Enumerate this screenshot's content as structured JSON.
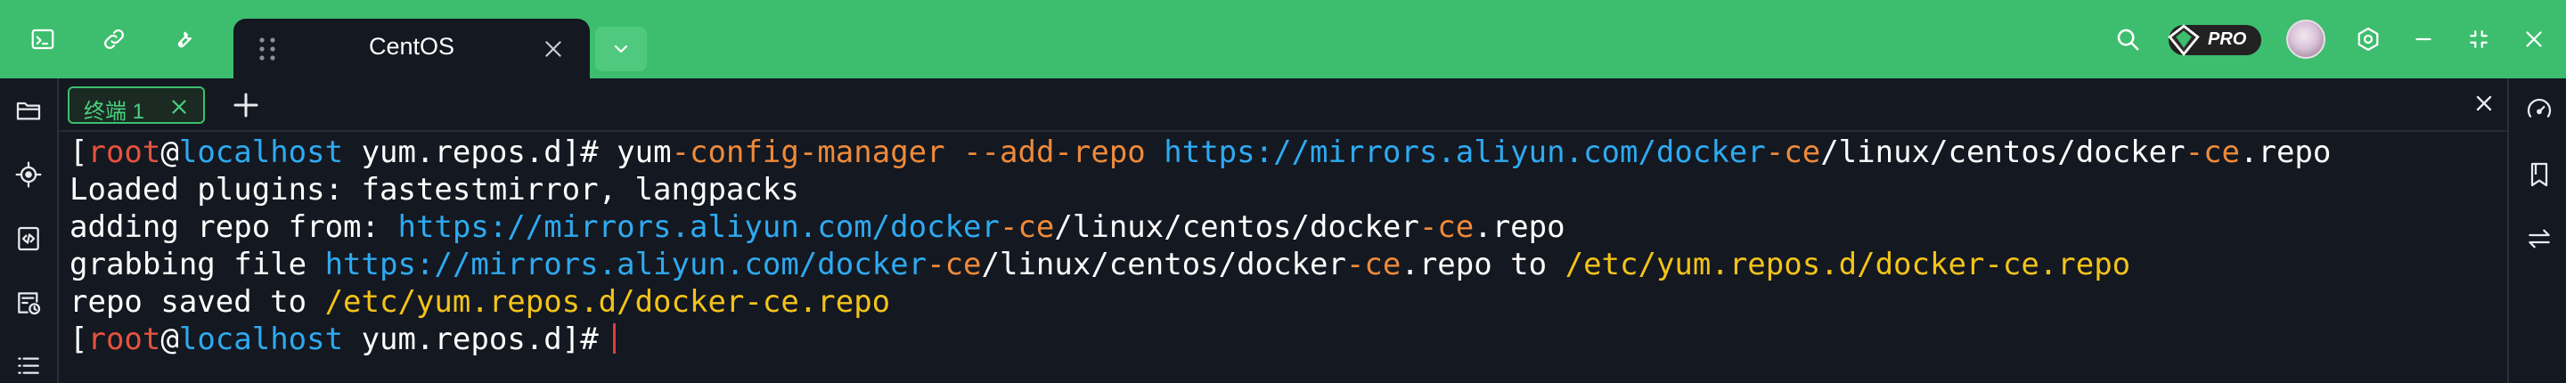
{
  "tab": {
    "title": "CentOS"
  },
  "pro_badge": {
    "text": "PRO"
  },
  "terminal_tab": {
    "label": "终端 1"
  },
  "terminal": {
    "line1": {
      "br_open": "[",
      "user": "root",
      "at": "@",
      "host": "localhost",
      "dir_part": " yum.repos.d]# ",
      "cmd_a": "yum",
      "cmd_b": "-config-manager --add-repo ",
      "url1": "https://mirrors.aliyun.com/docker",
      "url2": "-ce",
      "url3": "/linux/centos/docker",
      "url4": "-ce",
      "url5": ".repo"
    },
    "line2": {
      "text": "Loaded plugins: fastestmirror, langpacks"
    },
    "line3": {
      "prefix": "adding repo from: ",
      "url1": "https://mirrors.aliyun.com/docker",
      "url2": "-ce",
      "url3": "/linux/centos/docker",
      "url4": "-ce",
      "url5": ".repo"
    },
    "line4": {
      "prefix": "grabbing file ",
      "url1": "https://mirrors.aliyun.com/docker",
      "url2": "-ce",
      "url3": "/linux/centos/docker",
      "url4": "-ce",
      "url5": ".repo",
      "to": " to ",
      "path": "/etc/yum.repos.d/docker-ce.repo"
    },
    "line5": {
      "prefix": "repo saved to ",
      "path": "/etc/yum.repos.d/docker-ce.repo"
    },
    "line6": {
      "br_open": "[",
      "user": "root",
      "at": "@",
      "host": "localhost",
      "dir_part": " yum.repos.d]#"
    }
  },
  "icons": {
    "titlebar_left": [
      "terminal-icon",
      "link-icon",
      "wrench-icon"
    ],
    "titlebar_right": [
      "search-icon",
      "pro-badge",
      "avatar",
      "settings-icon",
      "minimize-icon",
      "restore-icon",
      "close-icon"
    ],
    "left_sidebar": [
      "folder-icon",
      "crosshair-icon",
      "code-icon",
      "history-icon",
      "list-icon"
    ],
    "right_sidebar": [
      "speedometer-icon",
      "bookmark-icon",
      "transfer-icon"
    ]
  },
  "colors": {
    "titlebar": "#3dbe6e",
    "terminal_bg": "#141821",
    "prompt_user": "#e5533d",
    "prompt_host": "#2eaaf0",
    "url": "#2eaaf0",
    "dash_highlight": "#ee8a3a",
    "path": "#f3c318",
    "cursor": "#e23c3c"
  }
}
